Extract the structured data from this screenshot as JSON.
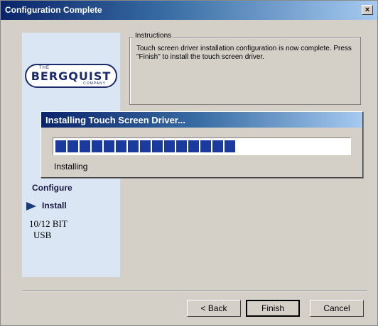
{
  "window": {
    "title": "Configuration Complete",
    "close_label": "×"
  },
  "logo": {
    "the": "THE",
    "name": "BERGQUIST",
    "company": "COMPANY"
  },
  "steps": {
    "configure": "Configure",
    "install": "Install"
  },
  "device": {
    "line1": "10/12 BIT",
    "line2": "USB"
  },
  "instructions": {
    "legend": "Instructions",
    "text": "Touch screen driver installation configuration is now complete.  Press \"Finish\" to install the touch screen driver."
  },
  "progress_dialog": {
    "title": "Installing Touch Screen Driver...",
    "status": "Installing",
    "progress_fraction": 0.6
  },
  "buttons": {
    "back": "< Back",
    "finish": "Finish",
    "cancel": "Cancel"
  },
  "colors": {
    "titlebar": "#0a246a",
    "progress": "#1a3aa0",
    "panel": "#dbe6f5"
  }
}
